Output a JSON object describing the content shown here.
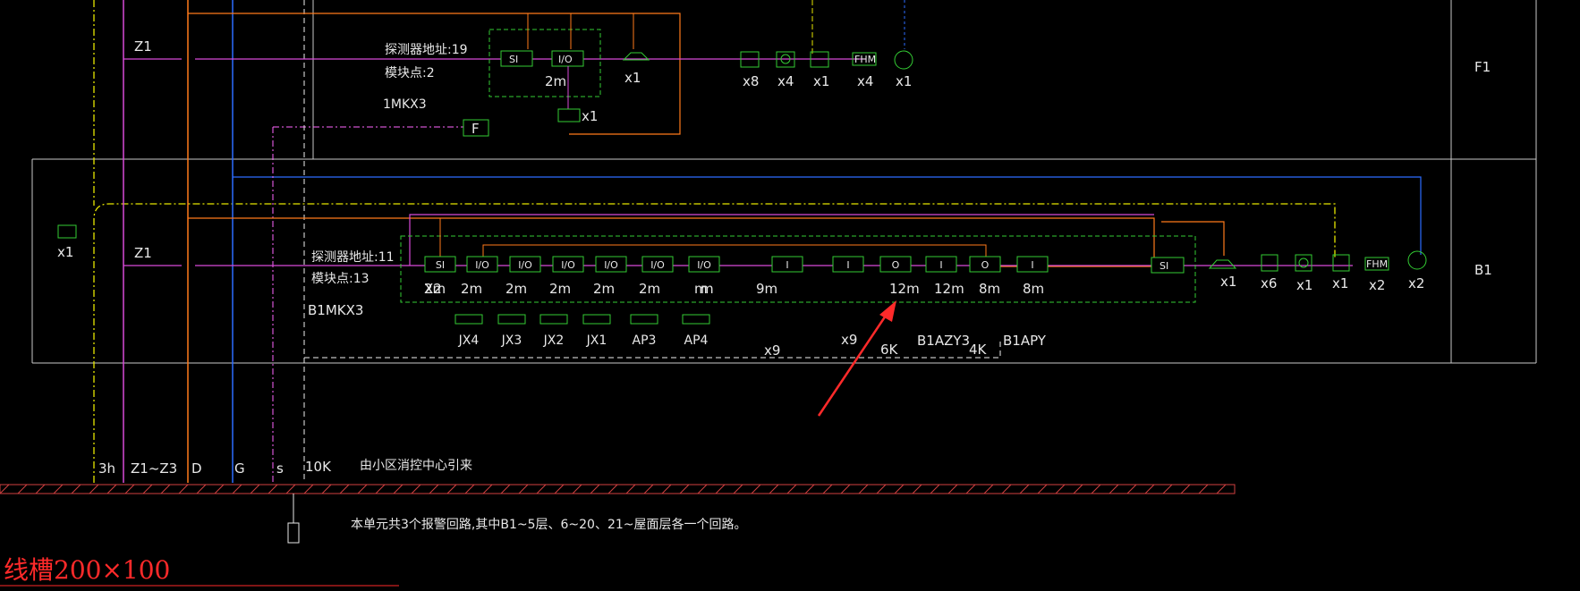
{
  "floors": {
    "f1": "F1",
    "b1": "B1"
  },
  "trunk": {
    "z1_upper": "Z1",
    "z1_lower": "Z1"
  },
  "bottom_labels": [
    "3h",
    "Z1~Z3",
    "D",
    "G",
    "s",
    "10K"
  ],
  "source_note": "由小区消控中心引来",
  "footnote": "本单元共3个报警回路,其中B1~5层、6~20、21~屋面层各一个回路。",
  "trunking_label": "线槽200×100",
  "f1": {
    "detector_addr": "探测器地址:19",
    "module_pts": "模块点:2",
    "box_name": "1MKX3",
    "si": "SI",
    "io": "I/O",
    "io_len": "2m",
    "valve_count": "x1",
    "f_box": "F",
    "right_counts": [
      "x1",
      "x8",
      "x4",
      "x1",
      "x4",
      "x1"
    ],
    "fhm": "FHM"
  },
  "b1": {
    "detector_addr": "探测器地址:11",
    "module_pts": "模块点:13",
    "box_name": "B1MKX3",
    "left_count": "x1",
    "si_count": "X2",
    "modules": [
      "SI",
      "I/O",
      "I/O",
      "I/O",
      "I/O",
      "I/O",
      "I/O",
      "I",
      "I",
      "O",
      "I",
      "O",
      "I"
    ],
    "lengths": [
      "2m",
      "2m",
      "2m",
      "2m",
      "2m",
      "2m",
      "m",
      "m",
      "9m",
      "12m",
      "12m",
      "8m",
      "8m"
    ],
    "panels": [
      "JX4",
      "JX3",
      "JX2",
      "JX1",
      "AP3",
      "AP4"
    ],
    "dev_counts": [
      "x9",
      "x9"
    ],
    "k_labels": [
      "6K",
      "4K"
    ],
    "fan_boxes": [
      "B1AZY3",
      "B1APY"
    ],
    "right_si": "SI",
    "right_counts": [
      "x1",
      "x6",
      "x1",
      "x1",
      "x2",
      "x2"
    ],
    "fhm": "FHM"
  }
}
